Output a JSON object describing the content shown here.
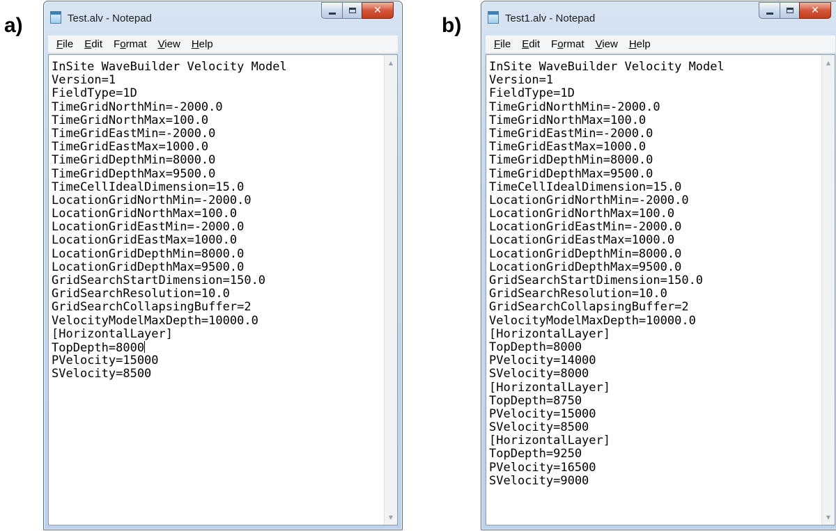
{
  "panels": [
    {
      "label": "a)",
      "window": {
        "title": "Test.alv - Notepad",
        "menu": [
          {
            "mnemonic": "F",
            "rest": "ile"
          },
          {
            "mnemonic": "E",
            "rest": "dit"
          },
          {
            "pre": "F",
            "mnemonic": "o",
            "rest": "rmat"
          },
          {
            "mnemonic": "V",
            "rest": "iew"
          },
          {
            "mnemonic": "H",
            "rest": "elp"
          }
        ],
        "lines": [
          "InSite WaveBuilder Velocity Model",
          "Version=1",
          "FieldType=1D",
          "TimeGridNorthMin=-2000.0",
          "TimeGridNorthMax=100.0",
          "TimeGridEastMin=-2000.0",
          "TimeGridEastMax=1000.0",
          "TimeGridDepthMin=8000.0",
          "TimeGridDepthMax=9500.0",
          "TimeCellIdealDimension=15.0",
          "LocationGridNorthMin=-2000.0",
          "LocationGridNorthMax=100.0",
          "LocationGridEastMin=-2000.0",
          "LocationGridEastMax=1000.0",
          "LocationGridDepthMin=8000.0",
          "LocationGridDepthMax=9500.0",
          "GridSearchStartDimension=150.0",
          "GridSearchResolution=10.0",
          "GridSearchCollapsingBuffer=2",
          "VelocityModelMaxDepth=10000.0",
          "[HorizontalLayer]",
          "TopDepth=8000",
          "PVelocity=15000",
          "SVelocity=8500"
        ],
        "caret_line": 21
      }
    },
    {
      "label": "b)",
      "window": {
        "title": "Test1.alv - Notepad",
        "menu": [
          {
            "mnemonic": "F",
            "rest": "ile"
          },
          {
            "mnemonic": "E",
            "rest": "dit"
          },
          {
            "pre": "F",
            "mnemonic": "o",
            "rest": "rmat"
          },
          {
            "mnemonic": "V",
            "rest": "iew"
          },
          {
            "mnemonic": "H",
            "rest": "elp"
          }
        ],
        "lines": [
          "InSite WaveBuilder Velocity Model",
          "Version=1",
          "FieldType=1D",
          "TimeGridNorthMin=-2000.0",
          "TimeGridNorthMax=100.0",
          "TimeGridEastMin=-2000.0",
          "TimeGridEastMax=1000.0",
          "TimeGridDepthMin=8000.0",
          "TimeGridDepthMax=9500.0",
          "TimeCellIdealDimension=15.0",
          "LocationGridNorthMin=-2000.0",
          "LocationGridNorthMax=100.0",
          "LocationGridEastMin=-2000.0",
          "LocationGridEastMax=1000.0",
          "LocationGridDepthMin=8000.0",
          "LocationGridDepthMax=9500.0",
          "GridSearchStartDimension=150.0",
          "GridSearchResolution=10.0",
          "GridSearchCollapsingBuffer=2",
          "VelocityModelMaxDepth=10000.0",
          "[HorizontalLayer]",
          "TopDepth=8000",
          "PVelocity=14000",
          "SVelocity=8000",
          "[HorizontalLayer]",
          "TopDepth=8750",
          "PVelocity=15000",
          "SVelocity=8500",
          "[HorizontalLayer]",
          "TopDepth=9250",
          "PVelocity=16500",
          "SVelocity=9000"
        ],
        "caret_line": -1
      }
    }
  ],
  "icons": {
    "minimize": "minimize-icon",
    "maximize": "maximize-icon",
    "close": "close-icon",
    "close_glyph": "✕",
    "scroll_up_glyph": "▲",
    "scroll_down_glyph": "▼"
  }
}
